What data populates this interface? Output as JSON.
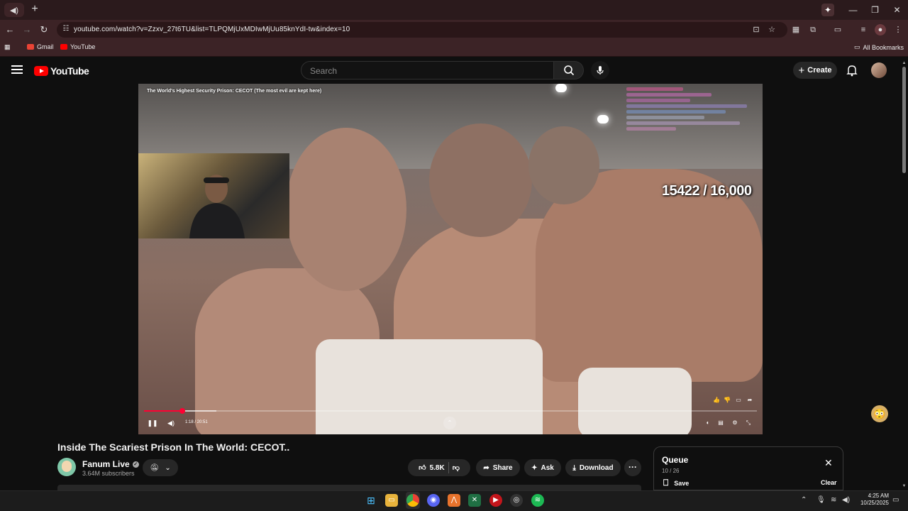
{
  "browser": {
    "tab_icon": "speaker-icon",
    "url": "youtube.com/watch?v=Zzxv_27t6TU&list=TLPQMjUxMDIwMjUu85knYdI-tw&index=10",
    "bookmarks": [
      {
        "label": "Gmail",
        "color": "#ea4335"
      },
      {
        "label": "YouTube",
        "color": "#ff0000"
      }
    ],
    "all_bookmarks": "All Bookmarks"
  },
  "youtube": {
    "logo_text": "YouTube",
    "search_placeholder": "Search",
    "create_label": "Create"
  },
  "video": {
    "overlay_title": "The World's Highest Security Prison: CECOT (The most evil are kept here)",
    "counter": "15422 / 16,000",
    "time": "1:18 / 20:51",
    "progress_fraction": 0.062,
    "buffer_fraction": 0.118,
    "accent": "#ff0033"
  },
  "meta": {
    "title": "Inside The Scariest Prison In The World: CECOT..",
    "channel": "Fanum Live",
    "subscribers": "3.64M subscribers",
    "likes": "5.8K",
    "share": "Share",
    "ask": "Ask",
    "download": "Download"
  },
  "queue": {
    "title": "Queue",
    "count": "10 / 26",
    "save": "Save",
    "clear": "Clear"
  },
  "system": {
    "time": "4:25 AM",
    "date": "10/25/2025"
  }
}
